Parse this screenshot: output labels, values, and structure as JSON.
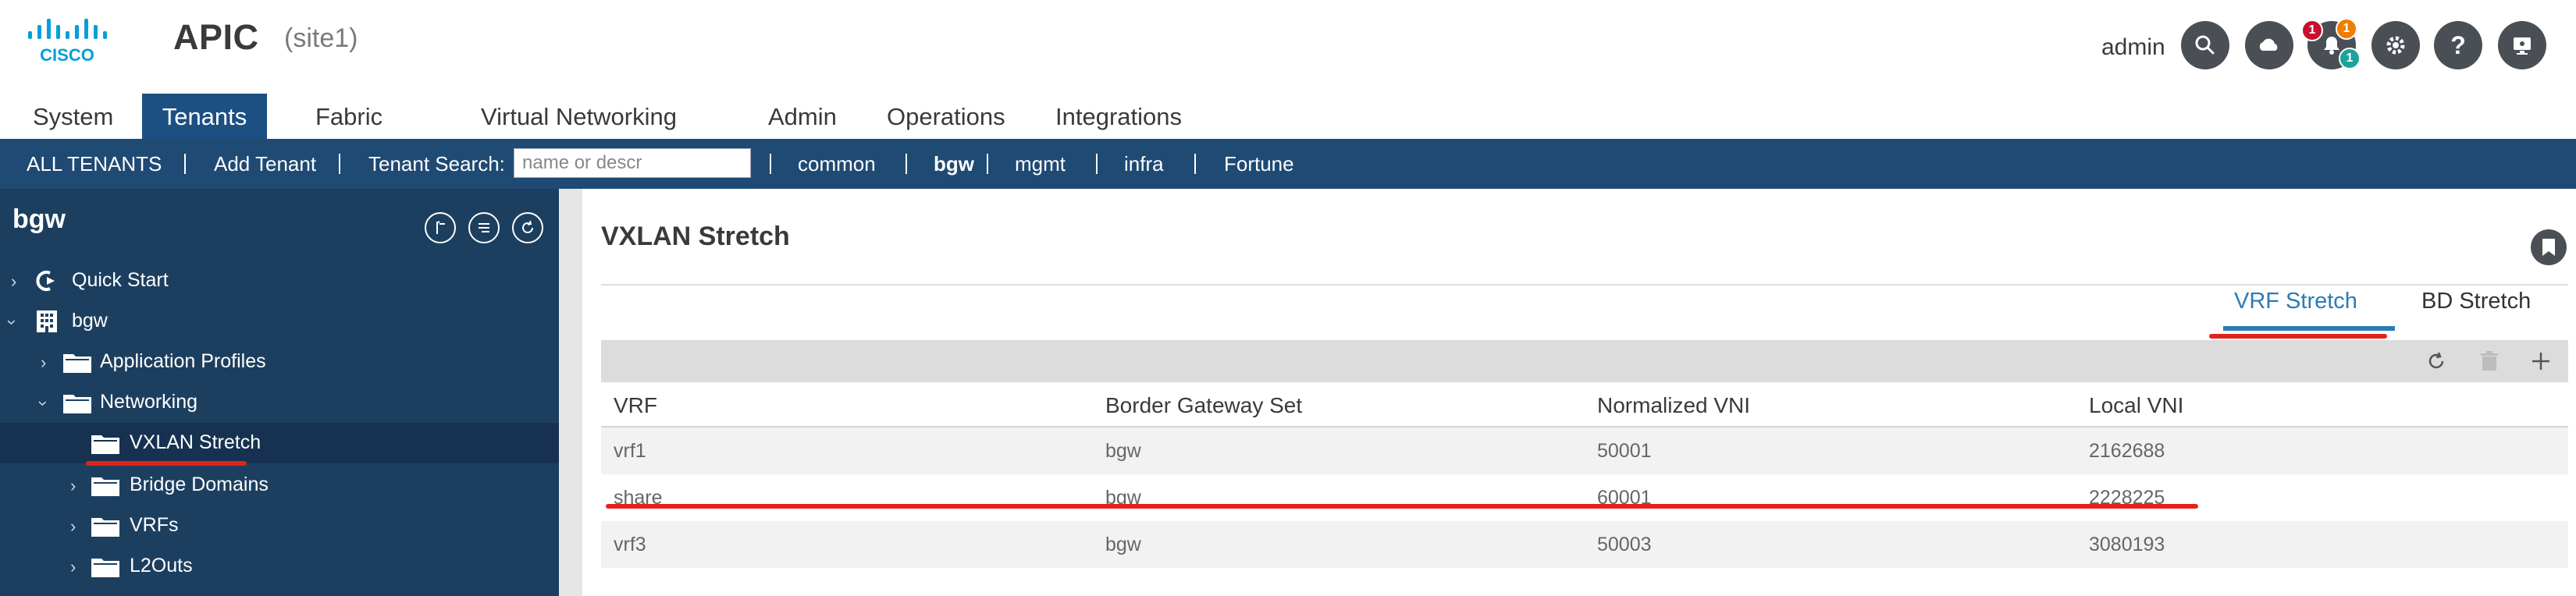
{
  "header": {
    "app_title": "APIC",
    "site": "(site1)",
    "user": "admin",
    "badges": {
      "critical": "1",
      "major": "1",
      "minor": "1"
    },
    "colors": {
      "critical": "#c8102e",
      "major": "#f07d00",
      "minor": "#1ba39c"
    },
    "icons": [
      "search-icon",
      "cloud-icon",
      "bell-icon",
      "gear-icon",
      "help-icon",
      "monitor-icon"
    ],
    "logo_text": "CISCO"
  },
  "main_tabs": [
    "System",
    "Tenants",
    "Fabric",
    "Virtual Networking",
    "Admin",
    "Operations",
    "Integrations"
  ],
  "subnav": {
    "all_tenants": "ALL TENANTS",
    "add_tenant": "Add Tenant",
    "search_label": "Tenant Search:",
    "search_placeholder": "name or descr",
    "tenants": [
      "common",
      "bgw",
      "mgmt",
      "infra",
      "Fortune"
    ]
  },
  "left_panel": {
    "title": "bgw",
    "tree": [
      "Quick Start",
      "bgw",
      "Application Profiles",
      "Networking",
      "VXLAN Stretch",
      "Bridge Domains",
      "VRFs",
      "L2Outs"
    ]
  },
  "content": {
    "title": "VXLAN Stretch",
    "tabs": [
      "VRF Stretch",
      "BD Stretch"
    ],
    "columns": [
      "VRF",
      "Border Gateway Set",
      "Normalized VNI",
      "Local VNI"
    ],
    "rows": [
      [
        "vrf1",
        "bgw",
        "50001",
        "2162688"
      ],
      [
        "share",
        "bgw",
        "60001",
        "2228225"
      ],
      [
        "vrf3",
        "bgw",
        "50003",
        "3080193"
      ]
    ],
    "accent": "#2b7cb5",
    "highlight": "#e2231a"
  }
}
